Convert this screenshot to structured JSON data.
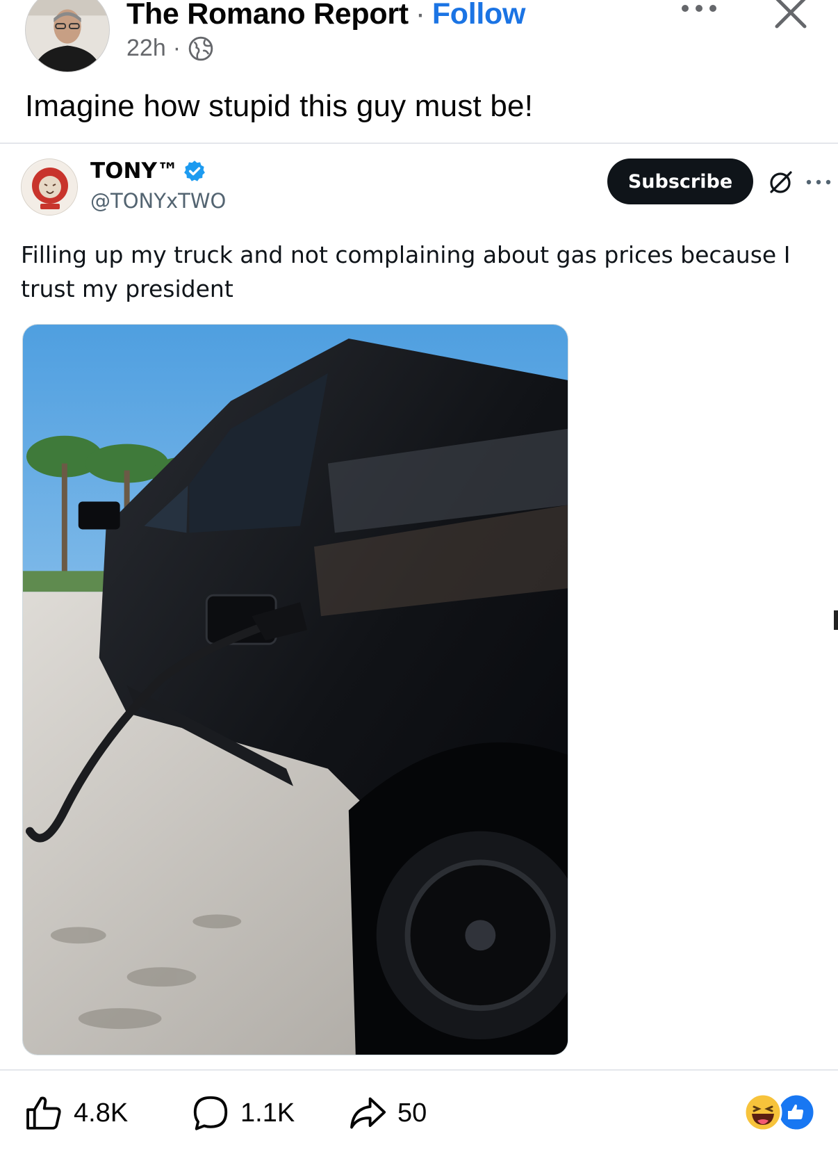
{
  "post": {
    "author": "The Romano Report",
    "separator": "·",
    "follow_label": "Follow",
    "time": "22h",
    "meta_separator": "·",
    "caption": "Imagine how stupid this guy must be!"
  },
  "tweet": {
    "display_name": "TONY™",
    "handle": "@TONYxTWO",
    "subscribe_label": "Subscribe",
    "text": "Filling up my truck and not complaining about gas prices because I trust my president"
  },
  "actions": {
    "likes": "4.8K",
    "comments": "1.1K",
    "shares": "50"
  },
  "colors": {
    "follow_blue": "#1b74e4",
    "verified_blue": "#1d9bf0",
    "subscribe_bg": "#0f1419",
    "meta_gray": "#65676b"
  },
  "icons": [
    "globe-icon",
    "more-icon",
    "close-icon",
    "verified-icon",
    "grok-icon",
    "like-icon",
    "comment-icon",
    "share-icon",
    "haha-reaction-icon",
    "like-reaction-icon"
  ]
}
